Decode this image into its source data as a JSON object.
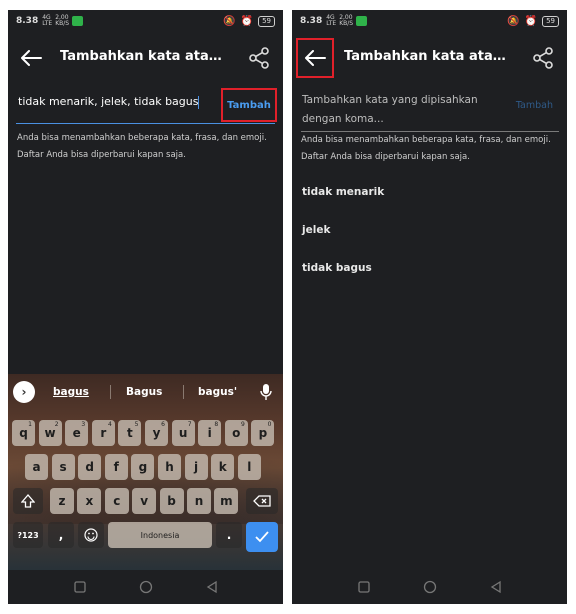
{
  "status": {
    "time": "8.38",
    "signal_top": "4G",
    "signal_bottom": "LTE",
    "speed_top": "2,00",
    "speed_bottom": "KB/S",
    "battery": "59"
  },
  "app_bar": {
    "title": "Tambahkan kata atau ..."
  },
  "left_screen": {
    "input_value": "tidak menarik, jelek, tidak bagus",
    "add_button": "Tambah",
    "help_text_line1": "Anda bisa menambahkan beberapa kata, frasa, dan emoji.",
    "help_text_line2": "Daftar Anda bisa diperbarui kapan saja."
  },
  "keyboard": {
    "suggestions": [
      "bagus",
      "Bagus",
      "bagus'"
    ],
    "row1": [
      {
        "k": "q",
        "n": "1"
      },
      {
        "k": "w",
        "n": "2"
      },
      {
        "k": "e",
        "n": "3"
      },
      {
        "k": "r",
        "n": "4"
      },
      {
        "k": "t",
        "n": "5"
      },
      {
        "k": "y",
        "n": "6"
      },
      {
        "k": "u",
        "n": "7"
      },
      {
        "k": "i",
        "n": "8"
      },
      {
        "k": "o",
        "n": "9"
      },
      {
        "k": "p",
        "n": "0"
      }
    ],
    "row2": [
      "a",
      "s",
      "d",
      "f",
      "g",
      "h",
      "j",
      "k",
      "l"
    ],
    "row3": [
      "z",
      "x",
      "c",
      "v",
      "b",
      "n",
      "m"
    ],
    "symbols_key": "?123",
    "comma_key": ",",
    "period_key": ".",
    "space_label": "Indonesia"
  },
  "right_screen": {
    "placeholder": "Tambahkan kata yang dipisahkan dengan koma...",
    "add_button": "Tambah",
    "help_text_line1": "Anda bisa menambahkan beberapa kata, frasa, dan emoji.",
    "help_text_line2": "Daftar Anda bisa diperbarui kapan saja.",
    "words": [
      "tidak menarik",
      "jelek",
      "tidak bagus"
    ]
  },
  "colors": {
    "background": "#1e1f22",
    "accent": "#4a9cf0",
    "highlight_box": "#e0202a",
    "enter_key": "#3d8ff0"
  }
}
